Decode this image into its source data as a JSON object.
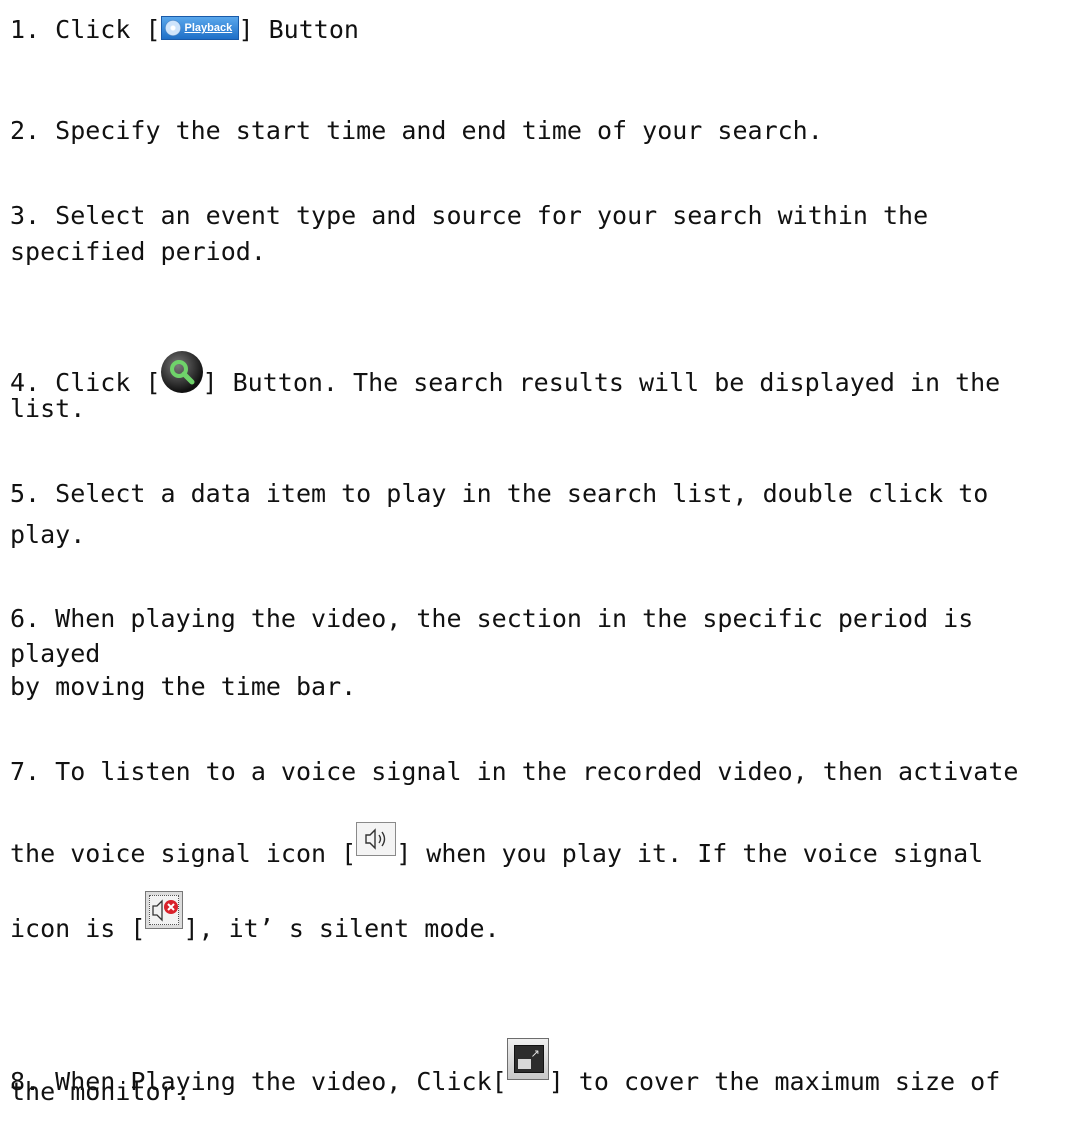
{
  "steps": {
    "s1": {
      "pre": "1. Click [",
      "post": "] Button"
    },
    "s2": "2. Specify the start time and end time of your search.",
    "s3": [
      "3. Select an event type and source for your search within the",
      "specified period."
    ],
    "s4": {
      "pre": "4. Click [",
      "post": "] Button. The search results will be displayed in the",
      "line2": "list."
    },
    "s5": [
      "5. Select a data item to play in the search list, double click to",
      "play."
    ],
    "s6": [
      "6. When playing the video, the section in the specific period is",
      "played",
      "by moving the time bar."
    ],
    "s7": {
      "line1": "7. To listen to a voice signal in the recorded video, then activate",
      "pre2": "the voice signal icon [",
      "post2": "] when you play it. If the voice signal",
      "pre3": "icon is [",
      "post3": "], it’ s silent mode."
    },
    "s8": {
      "pre": "8. When Playing the video, Click[",
      "post": "] to cover the maximum size of",
      "line2": "the monitor."
    }
  },
  "icons": {
    "playback": {
      "name": "playback-icon",
      "label": "Playback"
    },
    "search": {
      "name": "search-icon"
    },
    "voice": {
      "name": "speaker-icon"
    },
    "mute": {
      "name": "speaker-muted-icon"
    },
    "fullscreen": {
      "name": "fullscreen-icon"
    }
  },
  "colors": {
    "text": "#111111",
    "playback_blue": "#1e6fc7",
    "search_green": "#4caf50",
    "mute_red": "#d9212b"
  }
}
